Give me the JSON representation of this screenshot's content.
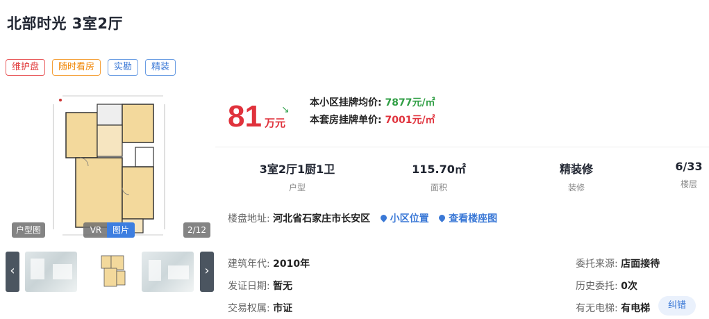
{
  "listing": {
    "title": "北部时光 3室2厅",
    "tags": [
      "维护盘",
      "随时看房",
      "实勘",
      "精装"
    ]
  },
  "gallery": {
    "badge_plan": "户型图",
    "badge_vr": "VR",
    "badge_photos": "图片",
    "counter": "2/12",
    "prev_icon": "chevron-left-icon",
    "next_icon": "chevron-right-icon"
  },
  "price": {
    "total": "81",
    "unit": "万元",
    "community_avg_label": "本小区挂牌均价:",
    "community_avg_value": "7877元/㎡",
    "unit_price_label": "本套房挂牌单价:",
    "unit_price_value": "7001元/㎡",
    "trend_icon": "trend-down-icon"
  },
  "facts": [
    {
      "value": "3室2厅1厨1卫",
      "label": "户型"
    },
    {
      "value": "115.70㎡",
      "label": "面积"
    },
    {
      "value": "精装修",
      "label": "装修"
    },
    {
      "value": "6/33",
      "label": "楼层"
    }
  ],
  "address": {
    "label": "楼盘地址:",
    "value": "河北省石家庄市长安区",
    "link_location": "小区位置",
    "link_building": "查看楼座图"
  },
  "details": {
    "year_label": "建筑年代:",
    "year_value": "2010年",
    "cert_label": "发证日期:",
    "cert_value": "暂无",
    "rights_label": "交易权属:",
    "rights_value": "市证",
    "source_label": "委托来源:",
    "source_value": "店面接待",
    "history_label": "历史委托:",
    "history_value": "0次",
    "elevator_label": "有无电梯:",
    "elevator_value": "有电梯",
    "correct_button": "纠错"
  },
  "colors": {
    "price_red": "#e0323c",
    "avg_green": "#2f9e44",
    "link_blue": "#3a78d6"
  }
}
